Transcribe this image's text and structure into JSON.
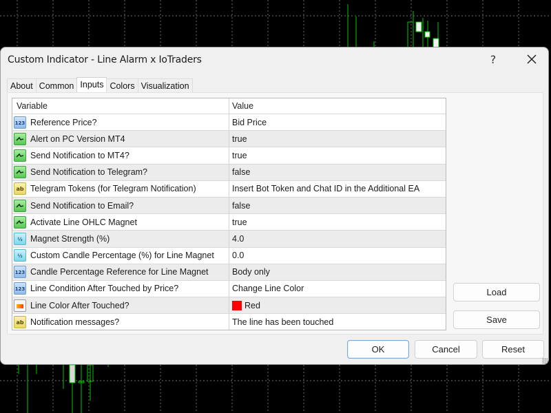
{
  "window": {
    "title": "Custom Indicator - Line Alarm x IoTraders",
    "help_label": "?",
    "close_icon": "close-icon"
  },
  "tabs": [
    {
      "label": "About",
      "active": false
    },
    {
      "label": "Common",
      "active": false
    },
    {
      "label": "Inputs",
      "active": true
    },
    {
      "label": "Colors",
      "active": false
    },
    {
      "label": "Visualization",
      "active": false
    }
  ],
  "inputs_table": {
    "columns": [
      "Variable",
      "Value"
    ],
    "rows": [
      {
        "type": "int",
        "icon_text": "123",
        "variable": "Reference Price?",
        "value": "Bid Price"
      },
      {
        "type": "bool",
        "icon_text": "",
        "variable": "Alert on PC Version MT4",
        "value": "true"
      },
      {
        "type": "bool",
        "icon_text": "",
        "variable": "Send Notification to MT4?",
        "value": "true"
      },
      {
        "type": "bool",
        "icon_text": "",
        "variable": "Send Notification to Telegram?",
        "value": "false"
      },
      {
        "type": "str",
        "icon_text": "ab",
        "variable": "Telegram Tokens (for Telegram Notification)",
        "value": "Insert Bot Token and Chat ID in the Additional EA"
      },
      {
        "type": "bool",
        "icon_text": "",
        "variable": "Send Notification to Email?",
        "value": "false"
      },
      {
        "type": "bool",
        "icon_text": "",
        "variable": "Activate Line OHLC Magnet",
        "value": "true"
      },
      {
        "type": "dbl",
        "icon_text": "½",
        "variable": "Magnet Strength (%)",
        "value": "4.0"
      },
      {
        "type": "dbl",
        "icon_text": "½",
        "variable": "Custom Candle Percentage (%) for Line Magnet",
        "value": "0.0"
      },
      {
        "type": "int",
        "icon_text": "123",
        "variable": "Candle Percentage Reference for Line Magnet",
        "value": "Body only"
      },
      {
        "type": "int",
        "icon_text": "123",
        "variable": "Line Condition After Touched by Price?",
        "value": "Change Line Color"
      },
      {
        "type": "color",
        "icon_text": "",
        "variable": "Line Color After Touched?",
        "value": "Red",
        "swatch": "#ff0000"
      },
      {
        "type": "str",
        "icon_text": "ab",
        "variable": "Notification messages?",
        "value": "The line has been touched"
      }
    ]
  },
  "side_buttons": {
    "load": "Load",
    "save": "Save"
  },
  "footer_buttons": {
    "ok": "OK",
    "cancel": "Cancel",
    "reset": "Reset"
  },
  "colors": {
    "chart_bg": "#000000",
    "candle_green": "#00c800",
    "grid": "#9a9a9a"
  }
}
